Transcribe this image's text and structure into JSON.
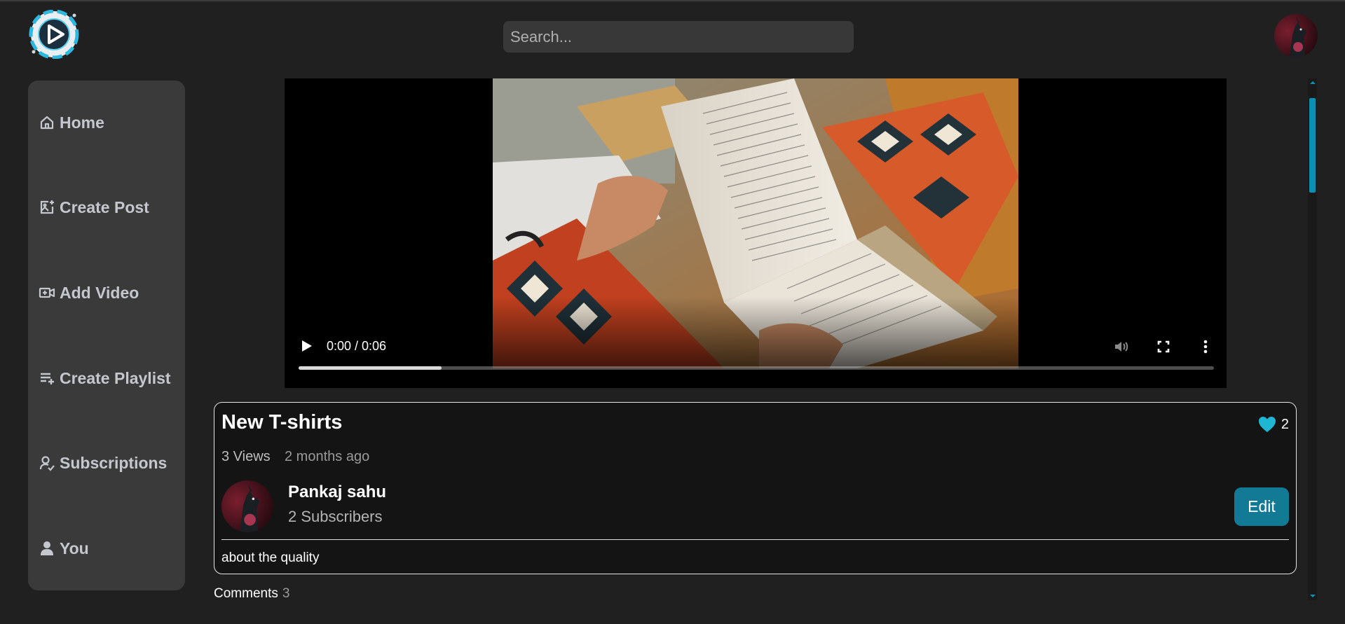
{
  "header": {
    "logo_icon": "play-logo-icon",
    "search_placeholder": "Search...",
    "avatar_icon": "user-avatar"
  },
  "sidebar": {
    "items": [
      {
        "label": "Home",
        "icon": "home-icon"
      },
      {
        "label": "Create Post",
        "icon": "image-plus-icon"
      },
      {
        "label": "Add Video",
        "icon": "video-plus-icon"
      },
      {
        "label": "Create Playlist",
        "icon": "playlist-add-icon"
      },
      {
        "label": "Subscriptions",
        "icon": "user-check-icon"
      },
      {
        "label": "You",
        "icon": "user-icon"
      }
    ]
  },
  "player": {
    "time": "0:00 / 0:06",
    "progress": 0.156
  },
  "video": {
    "title": "New T-shirts",
    "likes": "2",
    "views": "3 Views",
    "ago": "2 months ago",
    "description": "about the quality"
  },
  "channel": {
    "name": "Pankaj sahu",
    "subscribers": "2 Subscribers",
    "edit_label": "Edit"
  },
  "comments": {
    "label": "Comments",
    "count": "3"
  },
  "colors": {
    "accent": "#137a96",
    "like": "#1fb6d4",
    "background": "#202020",
    "sidebar": "#3a3a3a"
  }
}
